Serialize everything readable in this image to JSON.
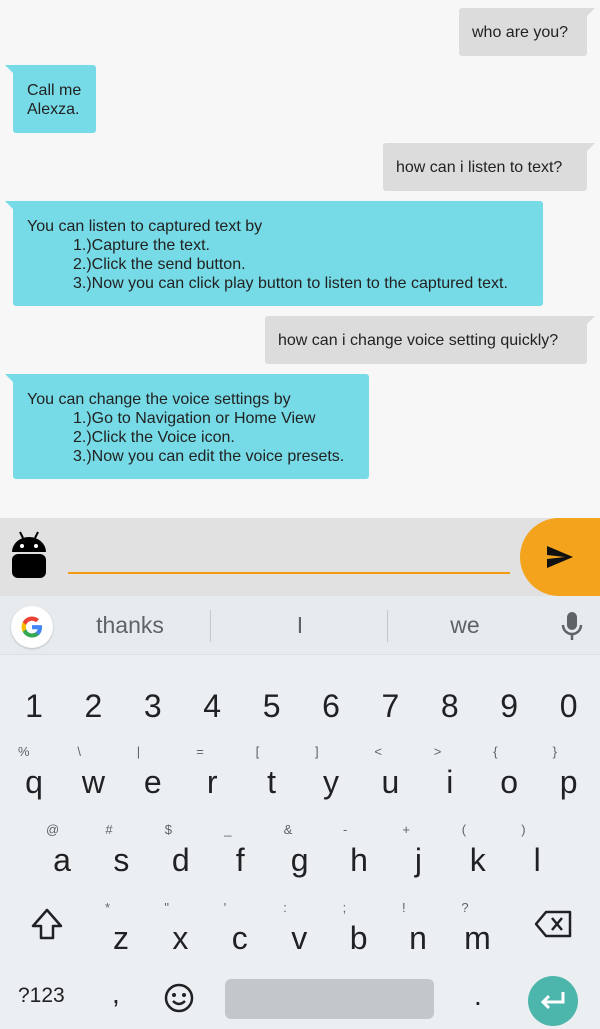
{
  "chat": {
    "messages": [
      {
        "from": "user",
        "lines": [
          "who are you?"
        ]
      },
      {
        "from": "bot",
        "lines": [
          "Call me",
          "Alexza."
        ]
      },
      {
        "from": "user",
        "lines": [
          "how can i listen to text?"
        ]
      },
      {
        "from": "bot",
        "intro": "You can listen to captured text by",
        "steps": [
          "1.)Capture the text.",
          "2.)Click the send button.",
          "3.)Now you can click play button to listen to the captured text."
        ]
      },
      {
        "from": "user",
        "lines": [
          "how can i change voice setting quickly?"
        ]
      },
      {
        "from": "bot",
        "intro": "You can change the voice settings by",
        "steps": [
          "1.)Go to Navigation or Home View",
          "2.)Click the Voice icon.",
          "3.)Now you can edit the voice presets."
        ]
      }
    ]
  },
  "composer": {
    "input_value": "",
    "placeholder": "",
    "accent_color": "#f4a31d",
    "avatar_icon": "android-icon",
    "send_icon": "send-icon"
  },
  "keyboard": {
    "suggestions": [
      "thanks",
      "I",
      "we"
    ],
    "number_row": [
      "1",
      "2",
      "3",
      "4",
      "5",
      "6",
      "7",
      "8",
      "9",
      "0"
    ],
    "row1": [
      {
        "key": "q",
        "hint": "%"
      },
      {
        "key": "w",
        "hint": "\\"
      },
      {
        "key": "e",
        "hint": "|"
      },
      {
        "key": "r",
        "hint": "="
      },
      {
        "key": "t",
        "hint": "["
      },
      {
        "key": "y",
        "hint": "]"
      },
      {
        "key": "u",
        "hint": "<"
      },
      {
        "key": "i",
        "hint": ">"
      },
      {
        "key": "o",
        "hint": "{"
      },
      {
        "key": "p",
        "hint": "}"
      }
    ],
    "row2": [
      {
        "key": "a",
        "hint": "@"
      },
      {
        "key": "s",
        "hint": "#"
      },
      {
        "key": "d",
        "hint": "$"
      },
      {
        "key": "f",
        "hint": "_"
      },
      {
        "key": "g",
        "hint": "&"
      },
      {
        "key": "h",
        "hint": "-"
      },
      {
        "key": "j",
        "hint": "+"
      },
      {
        "key": "k",
        "hint": "("
      },
      {
        "key": "l",
        "hint": ")"
      }
    ],
    "row3": [
      {
        "key": "z",
        "hint": "*"
      },
      {
        "key": "x",
        "hint": "\""
      },
      {
        "key": "c",
        "hint": "'"
      },
      {
        "key": "v",
        "hint": ":"
      },
      {
        "key": "b",
        "hint": ";"
      },
      {
        "key": "n",
        "hint": "!"
      },
      {
        "key": "m",
        "hint": "?"
      }
    ],
    "symbols_label": "?123",
    "comma_label": ",",
    "period_label": ".",
    "enter_color": "#4db6ac"
  }
}
